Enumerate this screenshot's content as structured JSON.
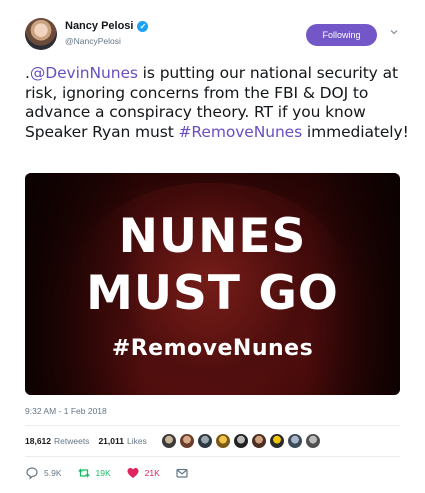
{
  "author": {
    "name": "Nancy Pelosi",
    "handle": "@NancyPelosi",
    "verified": true
  },
  "follow_button": {
    "label": "Following",
    "color": "#7357c9"
  },
  "tweet": {
    "prefix": ".",
    "mention": "@DevinNunes",
    "text_mid": " is putting our national security at risk, ignoring concerns from the FBI & DOJ to advance a conspiracy theory. RT if you know Speaker Ryan must ",
    "hashtag": "#RemoveNunes",
    "text_end": " immediately!",
    "link_color": "#6a4ec2"
  },
  "media": {
    "line1": "NUNES",
    "line2": "MUST GO",
    "line3": "#RemoveNunes"
  },
  "timestamp": "9:32 AM - 1 Feb 2018",
  "stats": {
    "retweets_count": "18,612",
    "retweets_label": "Retweets",
    "likes_count": "21,011",
    "likes_label": "Likes"
  },
  "actions": {
    "reply_count": "5.9K",
    "retweet_count": "19K",
    "like_count": "21K"
  },
  "colors": {
    "retweet": "#17bf63",
    "like": "#e0245e",
    "muted": "#657786"
  }
}
